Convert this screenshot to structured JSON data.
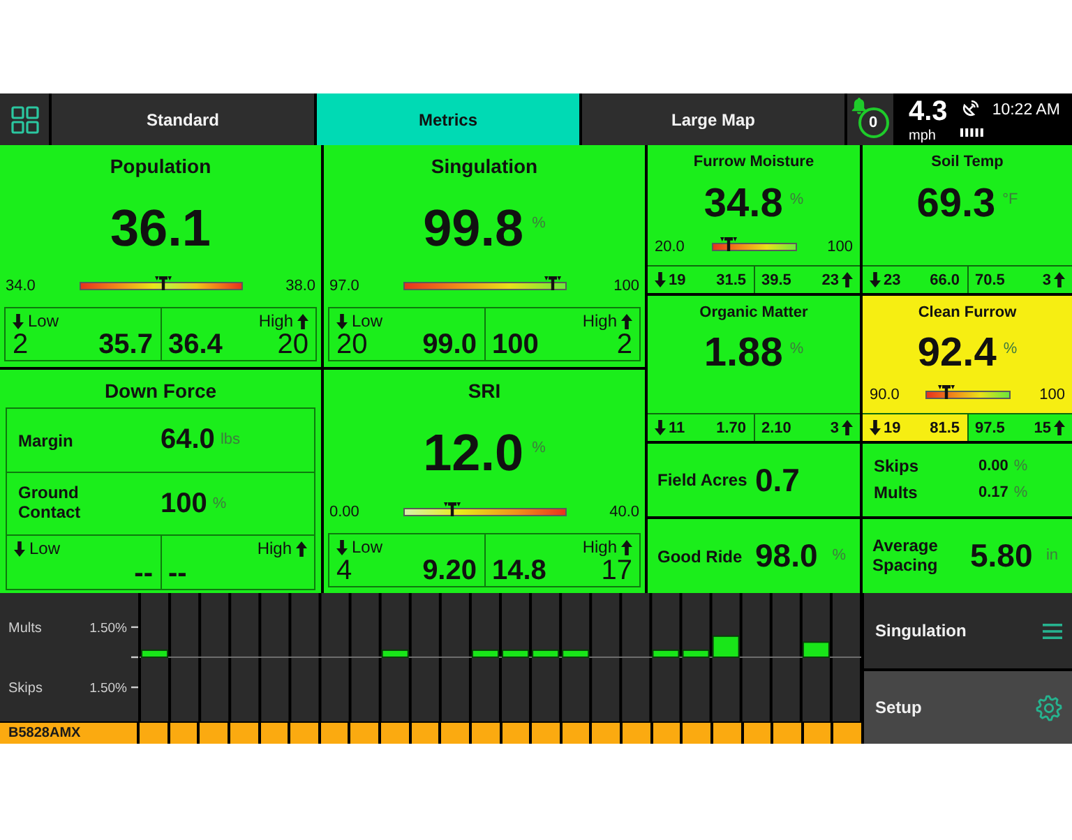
{
  "top_bar": {
    "tabs": [
      {
        "label": "Standard",
        "selected": false
      },
      {
        "label": "Metrics",
        "selected": true
      },
      {
        "label": "Large Map",
        "selected": false
      }
    ],
    "alerts": {
      "count": "0"
    },
    "speed": {
      "value": "4.3",
      "unit": "mph"
    },
    "clock": "10:22 AM"
  },
  "large_tiles": [
    {
      "kind": "gauge",
      "title": "Population",
      "value": "36.1",
      "gauge": {
        "kind": "symmetric",
        "min": "34.0",
        "max": "38.0",
        "level": 0.52
      },
      "low": {
        "label": "Low",
        "count": "2",
        "average": "35.7"
      },
      "high": {
        "label": "High",
        "average": "36.4",
        "count": "20"
      }
    },
    {
      "kind": "gauge",
      "title": "Singulation",
      "value": "99.8",
      "unit": "%",
      "gauge": {
        "kind": "rising",
        "min": "97.0",
        "max": "100",
        "level": 0.93
      },
      "low": {
        "label": "Low",
        "count": "20",
        "average": "99.0"
      },
      "high": {
        "label": "High",
        "average": "100",
        "count": "2"
      }
    },
    {
      "kind": "down-force",
      "title": "Down Force",
      "rows": [
        {
          "label": "Margin",
          "value": "64.0",
          "unit": "lbs"
        },
        {
          "label": "Ground Contact",
          "value": "100",
          "unit": "%"
        }
      ],
      "low": {
        "label": "Low",
        "average": "--"
      },
      "high": {
        "label": "High",
        "average": "--"
      }
    },
    {
      "kind": "gauge",
      "title": "SRI",
      "value": "12.0",
      "unit": "%",
      "gauge": {
        "kind": "falling",
        "min": "0.00",
        "max": "40.0",
        "level": 0.3
      },
      "low": {
        "label": "Low",
        "count": "4",
        "average": "9.20"
      },
      "high": {
        "label": "High",
        "average": "14.8",
        "count": "17"
      }
    }
  ],
  "small_tiles": [
    {
      "kind": "metric",
      "title": "Furrow Moisture",
      "color": "#1bee1b",
      "value": "34.8",
      "unit": "%",
      "gauge": {
        "kind": "rising",
        "min": "20.0",
        "max": "100",
        "level": 0.19
      },
      "low": {
        "count": "19",
        "average": "31.5",
        "color": "#1bee1b"
      },
      "high": {
        "average": "39.5",
        "count": "23",
        "color": "#1bee1b"
      }
    },
    {
      "kind": "metric",
      "title": "Soil Temp",
      "color": "#1bee1b",
      "value": "69.3",
      "unit": "°F",
      "low": {
        "count": "23",
        "average": "66.0",
        "color": "#1bee1b"
      },
      "high": {
        "average": "70.5",
        "count": "3",
        "color": "#1bee1b"
      }
    },
    {
      "kind": "metric",
      "title": "Organic Matter",
      "color": "#1bee1b",
      "value": "1.88",
      "unit": "%",
      "low": {
        "count": "11",
        "average": "1.70",
        "color": "#1bee1b"
      },
      "high": {
        "average": "2.10",
        "count": "3",
        "color": "#1bee1b"
      }
    },
    {
      "kind": "metric",
      "title": "Clean Furrow",
      "color": "#f6ee12",
      "value": "92.4",
      "unit": "%",
      "gauge": {
        "kind": "rising",
        "min": "90.0",
        "max": "100",
        "level": 0.24
      },
      "low": {
        "count": "19",
        "average": "81.5",
        "color": "#f6ee12"
      },
      "high": {
        "average": "97.5",
        "count": "15",
        "color": "#1bee1b"
      }
    },
    {
      "kind": "single",
      "color": "#1bee1b",
      "label": "Field Acres",
      "value": "0.7"
    },
    {
      "kind": "pair",
      "color": "#1bee1b",
      "rows": [
        {
          "label": "Skips",
          "value": "0.00",
          "unit": "%"
        },
        {
          "label": "Mults",
          "value": "0.17",
          "unit": "%"
        }
      ]
    },
    {
      "kind": "single",
      "color": "#1bee1b",
      "label": "Good Ride",
      "value": "98.0",
      "unit": "%"
    },
    {
      "kind": "single",
      "color": "#1bee1b",
      "label": "Average Spacing",
      "value": "5.80",
      "unit": "in"
    }
  ],
  "row_chart": {
    "chart_data": {
      "type": "bar",
      "series": [
        {
          "name": "Mults",
          "color": "#19e619",
          "values": [
            0.35,
            0,
            0,
            0,
            0,
            0,
            0,
            0,
            0.35,
            0,
            0,
            0.35,
            0.35,
            0.35,
            0.35,
            0,
            0,
            0.35,
            0.35,
            1.05,
            0,
            0,
            0.75,
            0
          ]
        },
        {
          "name": "Skips",
          "values": [
            0,
            0,
            0,
            0,
            0,
            0,
            0,
            0,
            0,
            0,
            0,
            0,
            0,
            0,
            0,
            0,
            0,
            0,
            0,
            0,
            0,
            0,
            0,
            0
          ]
        }
      ],
      "ylim": [
        -3.2,
        3.2
      ],
      "yticks": [
        {
          "value": 1.5,
          "label": "1.50%"
        },
        {
          "value": -1.5,
          "label": "1.50%"
        }
      ]
    },
    "planter": "B5828AMX"
  },
  "side_menu": [
    {
      "kind": "selector",
      "label": "Singulation"
    },
    {
      "kind": "button",
      "label": "Setup"
    }
  ]
}
